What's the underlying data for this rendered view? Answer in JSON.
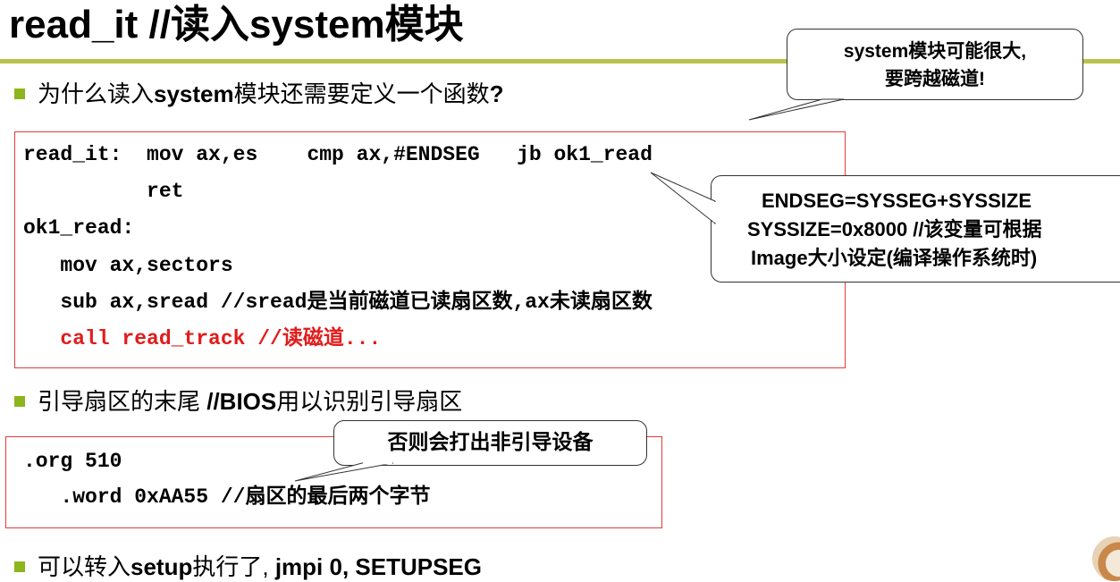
{
  "title": "read_it //读入system模块",
  "bullets": {
    "why_prefix": "为什么读入",
    "why_bold": "system",
    "why_suffix": "模块还需要定义一个函数",
    "why_q": "?",
    "boot_text": "引导扇区的末尾 ",
    "boot_bold": "//BIOS",
    "boot_suffix": "用以识别引导扇区",
    "setup_prefix": "可以转入",
    "setup_bold": "setup",
    "setup_suffix": "执行了,",
    "setup_code": " jmpi 0, SETUPSEG"
  },
  "code_block_1": {
    "line1": "read_it:  mov ax,es    cmp ax,#ENDSEG   jb ok1_read",
    "line2": "          ret",
    "line3": "ok1_read:",
    "line4": "   mov ax,sectors",
    "line5": "   sub ax,sread //sread是当前磁道已读扇区数,ax未读扇区数",
    "line6": "   call read_track //读磁道..."
  },
  "code_block_2": {
    "line1": ".org 510",
    "line2": "   .word 0xAA55 //扇区的最后两个字节"
  },
  "callouts": {
    "system_big_1": "system模块可能很大,",
    "system_big_2": "要跨越磁道!",
    "endseg_1": "ENDSEG=SYSSEG+SYSSIZE",
    "endseg_2": "SYSSIZE=0x8000 //该变量可根据",
    "endseg_3": "Image大小设定(编译操作系统时)",
    "non_boot": "否则会打出非引导设备"
  },
  "colors": {
    "accent_bar": "#b9c24a",
    "bullet_square": "#8db51c",
    "box_border": "#e53b3b",
    "code_red": "#e31b1b"
  },
  "icons": {
    "logo": "university-logo"
  }
}
